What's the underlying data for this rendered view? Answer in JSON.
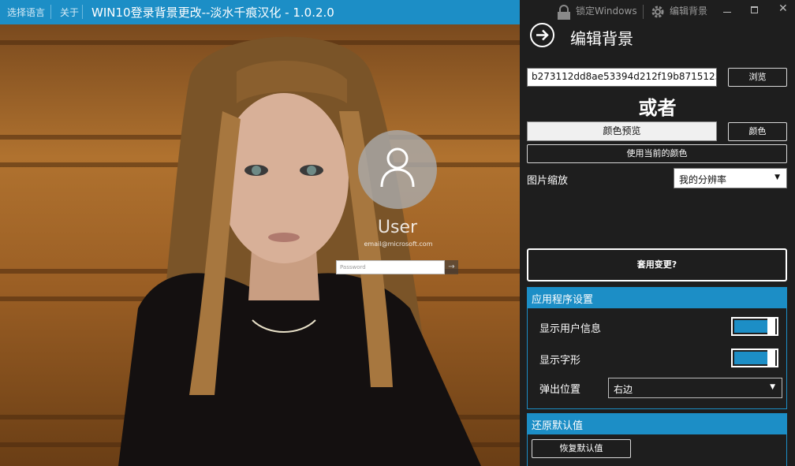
{
  "titlebar": {
    "select_language": "选择语言",
    "about": "关于",
    "app_title": "WIN10登录背景更改--淡水千痕汉化 - 1.0.2.0"
  },
  "window_controls": {
    "lock_windows": "锁定Windows",
    "edit_background": "编辑背景"
  },
  "lockscreen": {
    "username": "User",
    "email": "email@microsoft.com",
    "password_placeholder": "Password"
  },
  "panel": {
    "heading": "编辑背景",
    "image_path": "b273112dd8ae53394d212f19b8715125.jpeg",
    "browse_label": "浏览",
    "or_label": "或者",
    "color_preview_label": "颜色预览",
    "color_label": "颜色",
    "use_current_color_label": "使用当前的颜色",
    "scale_label": "图片缩放",
    "scale_value": "我的分辨率",
    "apply_label": "套用变更?"
  },
  "app_settings": {
    "title": "应用程序设置",
    "show_user_info": "显示用户信息",
    "show_user_info_on": true,
    "show_glyph": "显示字形",
    "show_glyph_on": true,
    "popup_position_label": "弹出位置",
    "popup_position_value": "右边"
  },
  "restore": {
    "title": "还原默认值",
    "restore_button": "恢复默认值"
  },
  "colors": {
    "accent": "#1c8ec6",
    "panel_bg": "#1e1e1e"
  }
}
